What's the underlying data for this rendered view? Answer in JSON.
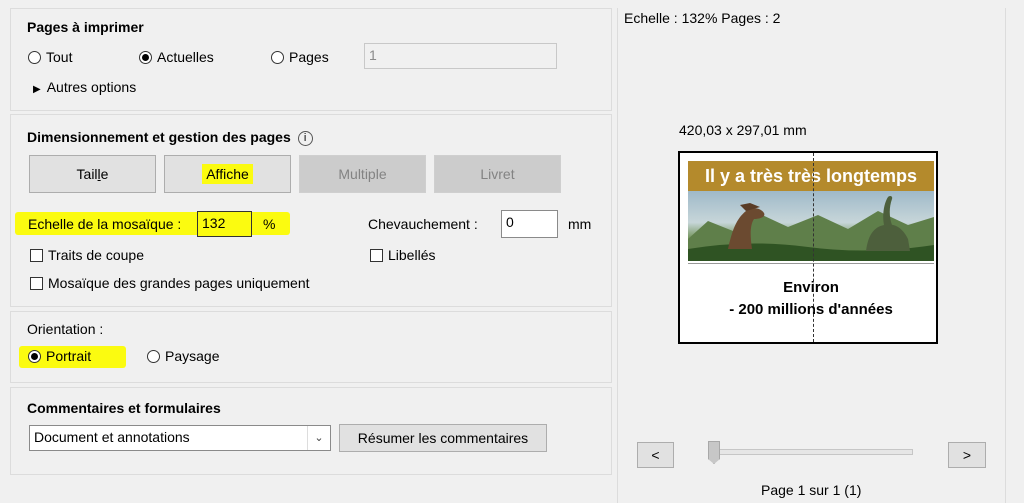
{
  "pages": {
    "title": "Pages à imprimer",
    "radio_all": "Tout",
    "radio_current": "Actuelles",
    "radio_pages": "Pages",
    "pages_value": "1",
    "more_options": "Autres options"
  },
  "sizing": {
    "title": "Dimensionnement et gestion des pages",
    "info_glyph": "i",
    "btn_size_pre": "Tail",
    "btn_size_ul": "l",
    "btn_size_post": "e",
    "btn_poster": "Affiche",
    "btn_multiple": "Multiple",
    "btn_booklet": "Livret",
    "scale_label": "Echelle de la mosaïque :",
    "scale_value": "132",
    "percent": "%",
    "overlap_label": "Chevauchement :",
    "overlap_value": "0",
    "overlap_unit": "mm",
    "cut_marks": "Traits de coupe",
    "labels": "Libellés",
    "large_only": "Mosaïque des grandes pages uniquement"
  },
  "orientation": {
    "title": "Orientation :",
    "portrait": "Portrait",
    "landscape": "Paysage"
  },
  "comments": {
    "title": "Commentaires et formulaires",
    "select_value": "Document et annotations",
    "summarize": "Résumer les commentaires"
  },
  "preview": {
    "scale_info": "Echelle : 132% Pages : 2",
    "dimensions": "420,03 x 297,01 mm",
    "banner": "Il y a très très longtemps",
    "line1": "Environ",
    "line2": "- 200 millions d'années",
    "prev": "<",
    "next": ">",
    "page_info": "Page 1 sur 1 (1)",
    "slider_position": 0
  },
  "colors": {
    "highlight": "#fbfb10",
    "banner_bg": "#b48a2c"
  }
}
